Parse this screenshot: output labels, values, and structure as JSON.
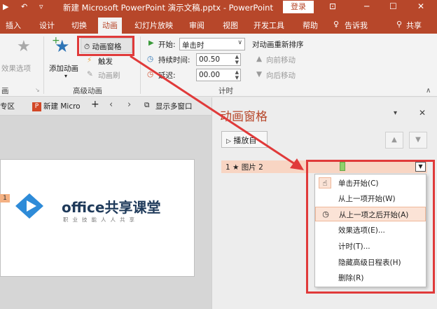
{
  "titlebar": {
    "title": "新建 Microsoft PowerPoint 演示文稿.pptx  -  PowerPoint",
    "login": "登录",
    "icons": [
      "slideshow-icon",
      "undo-icon",
      "quick-access-dropdown-icon",
      "ribbon-display-icon",
      "minimize-icon",
      "maximize-icon",
      "close-icon"
    ]
  },
  "tabs": {
    "items": [
      "插入",
      "设计",
      "切换",
      "动画",
      "幻灯片放映",
      "审阅",
      "视图",
      "开发工具",
      "帮助"
    ],
    "active": "动画",
    "tell_me": "告诉我",
    "share": "共享"
  },
  "ribbon": {
    "effect_options": "效果选项",
    "add_animation": "添加动画",
    "animation_pane": "动画窗格",
    "trigger": "触发",
    "animation_painter": "动画刷",
    "group_advanced": "高级动画",
    "start_label": "开始:",
    "start_value": "单击时",
    "duration_label": "持续时间:",
    "duration_value": "00.50",
    "delay_label": "延迟:",
    "delay_value": "00.00",
    "group_timing": "计时",
    "reorder_title": "对动画重新排序",
    "move_earlier": "向前移动",
    "move_later": "向后移动",
    "group_left_1": "画",
    "group_left_2": "画"
  },
  "doctabs": {
    "tab_prev": "专区",
    "tab_active": "新建 Micro",
    "add": "+",
    "multi_window": "显示多窗口"
  },
  "slide": {
    "number_tag": "1",
    "logo_text": "office共享课堂",
    "logo_sub": "职业技能人人共享"
  },
  "pane": {
    "title": "动画窗格",
    "play_button": "播放自",
    "item_label": "1  ★  图片 2"
  },
  "context_menu": {
    "items": [
      {
        "label": "单击开始(C)",
        "icon": "mouse-click-icon",
        "highlight": false
      },
      {
        "label": "从上一项开始(W)",
        "icon": "",
        "highlight": false
      },
      {
        "label": "从上一项之后开始(A)",
        "icon": "clock-icon",
        "highlight": true
      },
      {
        "label": "效果选项(E)...",
        "icon": "",
        "highlight": false
      },
      {
        "label": "计时(T)...",
        "icon": "",
        "highlight": false
      },
      {
        "label": "隐藏高级日程表(H)",
        "icon": "",
        "highlight": false
      },
      {
        "label": "删除(R)",
        "icon": "",
        "highlight": false
      }
    ]
  },
  "colors": {
    "brand": "#b7472a",
    "highlight_box": "#e03a3a",
    "item_highlight": "#fbe3d6"
  }
}
